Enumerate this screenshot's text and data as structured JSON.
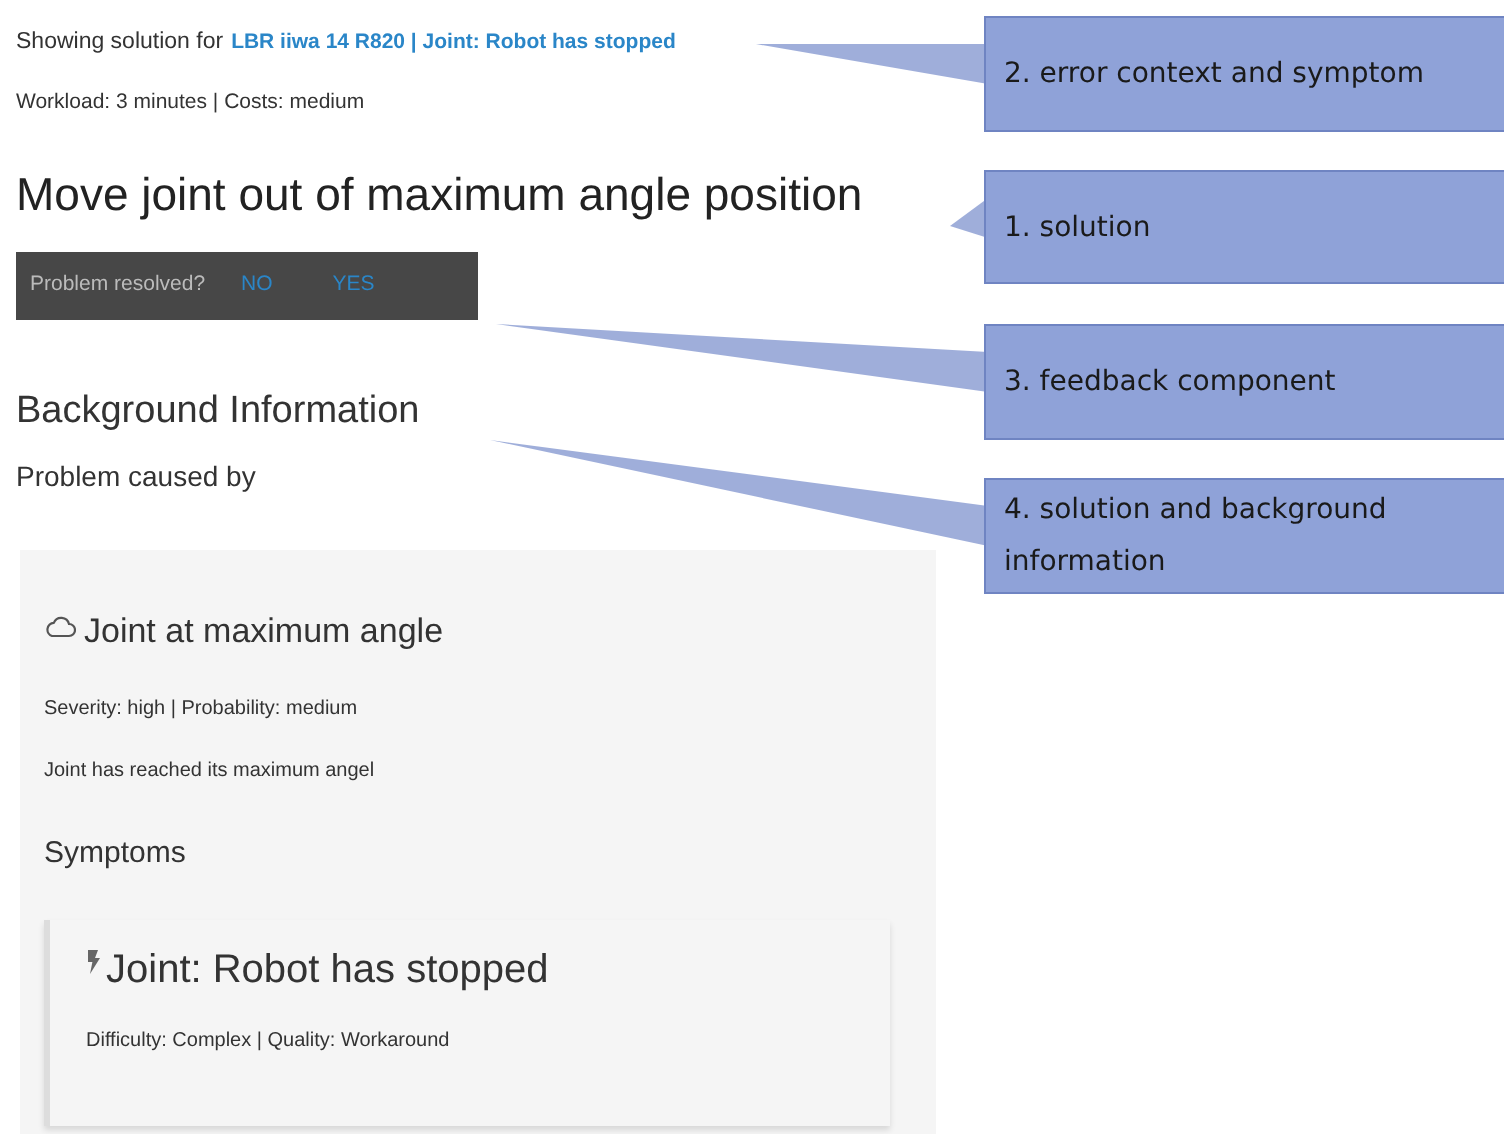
{
  "header": {
    "prefix": "Showing solution for",
    "link": "LBR iiwa 14 R820 | Joint: Robot has stopped",
    "meta": "Workload: 3 minutes | Costs: medium"
  },
  "solution_title": "Move joint out of maximum angle position",
  "feedback": {
    "question": "Problem resolved?",
    "options": [
      {
        "label": "NO"
      },
      {
        "label": "YES"
      }
    ]
  },
  "background": {
    "title": "Background Information",
    "subtitle": "Problem caused by"
  },
  "cause": {
    "title": "Joint at maximum angle",
    "meta": "Severity: high | Probability: medium",
    "description": "Joint has reached its maximum angel",
    "symptoms_title": "Symptoms",
    "symptom": {
      "title": "Joint: Robot has stopped",
      "meta": "Difficulty: Complex | Quality: Workaround"
    }
  },
  "callouts": [
    {
      "text": "2. error context and symptom"
    },
    {
      "text": "1. solution"
    },
    {
      "text": "3. feedback component"
    },
    {
      "text": "4. solution and background information"
    }
  ]
}
